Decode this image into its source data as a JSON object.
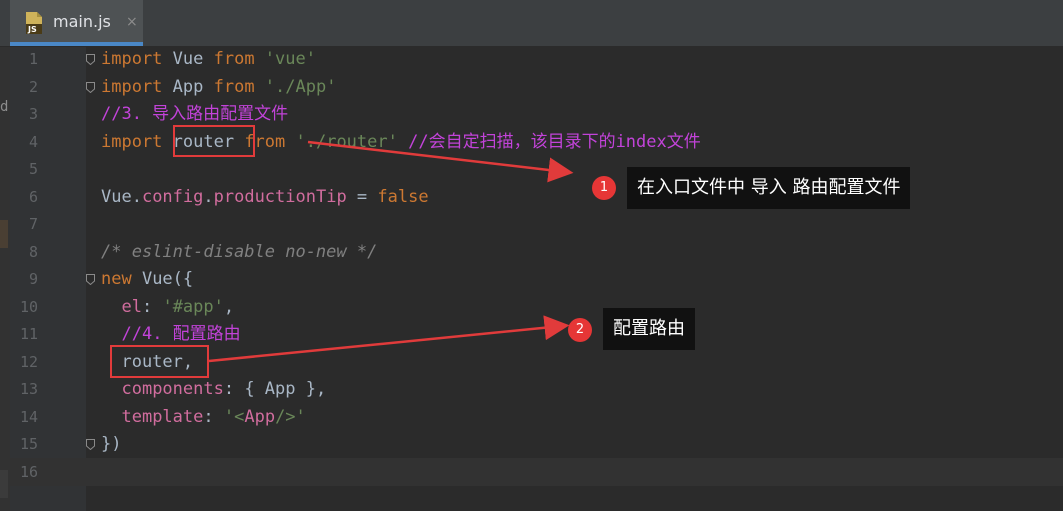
{
  "tab": {
    "label": "main.js",
    "icon": "js-file-icon",
    "badge_text": "JS",
    "close_glyph": "×"
  },
  "left_strip": {
    "letter": "d"
  },
  "lines": [
    {
      "num": "1",
      "tokens": [
        [
          "kw",
          "import "
        ],
        [
          "plain",
          "Vue "
        ],
        [
          "kw",
          "from "
        ],
        [
          "str",
          "'vue'"
        ]
      ],
      "fold": true
    },
    {
      "num": "2",
      "tokens": [
        [
          "kw",
          "import "
        ],
        [
          "plain",
          "App "
        ],
        [
          "kw",
          "from "
        ],
        [
          "str",
          "'./App'"
        ]
      ],
      "fold": true
    },
    {
      "num": "3",
      "tokens": [
        [
          "acm",
          "//3. 导入路由配置文件"
        ]
      ]
    },
    {
      "num": "4",
      "tokens": [
        [
          "kw",
          "import "
        ],
        [
          "plain",
          "router "
        ],
        [
          "kw",
          "from "
        ],
        [
          "str",
          "'./router' "
        ],
        [
          "acm",
          "//会自定扫描，该目录下的index文件"
        ]
      ]
    },
    {
      "num": "5",
      "tokens": []
    },
    {
      "num": "6",
      "tokens": [
        [
          "plain",
          "Vue."
        ],
        [
          "pink",
          "config"
        ],
        [
          "plain",
          "."
        ],
        [
          "pink",
          "productionTip"
        ],
        [
          "plain",
          " = "
        ],
        [
          "kw",
          "false"
        ]
      ]
    },
    {
      "num": "7",
      "tokens": []
    },
    {
      "num": "8",
      "tokens": [
        [
          "cm",
          "/* eslint-disable no-new */"
        ]
      ]
    },
    {
      "num": "9",
      "tokens": [
        [
          "kw",
          "new "
        ],
        [
          "plain",
          "Vue({"
        ]
      ],
      "fold": true
    },
    {
      "num": "10",
      "tokens": [
        [
          "plain",
          "  "
        ],
        [
          "pink",
          "el"
        ],
        [
          "plain",
          ": "
        ],
        [
          "str",
          "'#app'"
        ],
        [
          "plain",
          ","
        ]
      ]
    },
    {
      "num": "11",
      "tokens": [
        [
          "plain",
          "  "
        ],
        [
          "acm",
          "//4. 配置路由"
        ]
      ]
    },
    {
      "num": "12",
      "tokens": [
        [
          "plain",
          "  router,"
        ]
      ]
    },
    {
      "num": "13",
      "tokens": [
        [
          "plain",
          "  "
        ],
        [
          "pink",
          "components"
        ],
        [
          "plain",
          ": { App },"
        ]
      ]
    },
    {
      "num": "14",
      "tokens": [
        [
          "plain",
          "  "
        ],
        [
          "pink",
          "template"
        ],
        [
          "plain",
          ": "
        ],
        [
          "str",
          "'<"
        ],
        [
          "pink",
          "App"
        ],
        [
          "str",
          "/>'"
        ]
      ]
    },
    {
      "num": "15",
      "tokens": [
        [
          "plain",
          "})"
        ]
      ],
      "fold": true
    },
    {
      "num": "16",
      "tokens": []
    }
  ],
  "annotations": [
    {
      "number": "1",
      "text": "在入口文件中 导入 路由配置文件"
    },
    {
      "number": "2",
      "text": "配置路由"
    }
  ],
  "colors": {
    "accent": "#e13b3b",
    "tab_underline": "#4a88c7"
  }
}
